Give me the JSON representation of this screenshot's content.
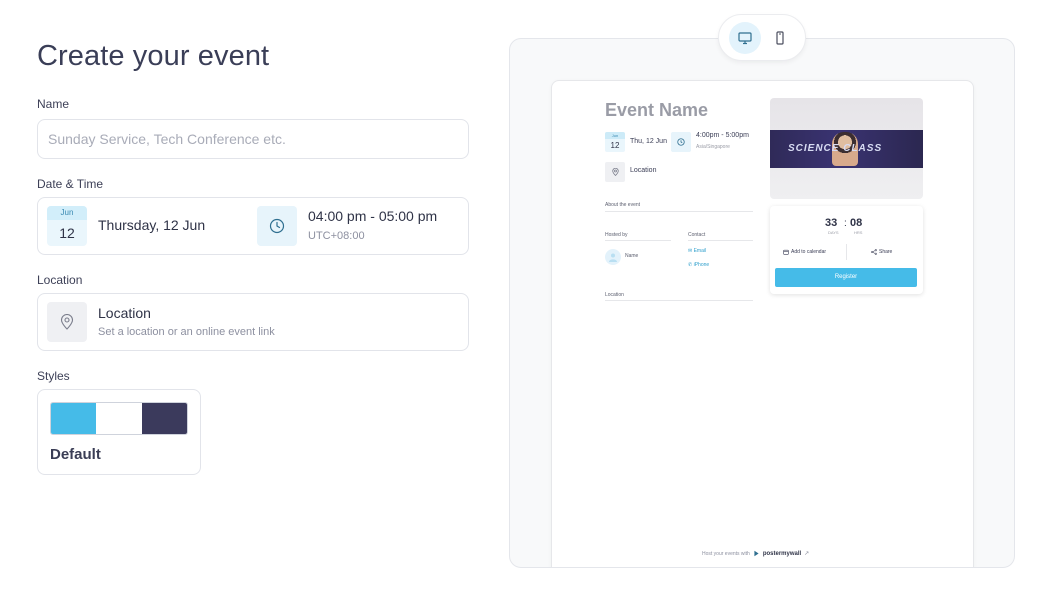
{
  "form": {
    "title": "Create your event",
    "name": {
      "label": "Name",
      "placeholder": "Sunday Service, Tech Conference etc.",
      "value": ""
    },
    "datetime": {
      "label": "Date & Time",
      "month": "Jun",
      "day": "12",
      "date_text": "Thursday, 12 Jun",
      "time_text": "04:00 pm - 05:00 pm",
      "timezone": "UTC+08:00"
    },
    "location": {
      "label": "Location",
      "title": "Location",
      "subtitle": "Set a location or an online event link"
    },
    "styles": {
      "label": "Styles",
      "selected": "Default",
      "swatch_colors": [
        "#45bbe8",
        "#ffffff",
        "#3b3a5c"
      ]
    }
  },
  "preview": {
    "mode": "desktop",
    "event_name": "Event Name",
    "month": "Jun",
    "day": "12",
    "date_text": "Thu, 12 Jun",
    "time_text": "4:00pm - 5:00pm",
    "timezone": "Asia/Singapore",
    "location": "Location",
    "about_label": "About the event",
    "hosted_by_label": "Hosted by",
    "host_name": "Name",
    "contact_label": "Contact",
    "contact_email": "Email",
    "contact_phone": "iPhone",
    "location_label": "Location",
    "image_text": "SCIENCE CLASS",
    "countdown": {
      "first": "33",
      "first_label": "DAYS",
      "second": "08",
      "second_label": "HRS"
    },
    "add_to_calendar": "Add to calendar",
    "share": "Share",
    "register": "Register",
    "footer_text": "Host your events with",
    "footer_brand": "postermywall"
  },
  "colors": {
    "accent": "#45bbe8",
    "dark": "#3b3a5c"
  }
}
